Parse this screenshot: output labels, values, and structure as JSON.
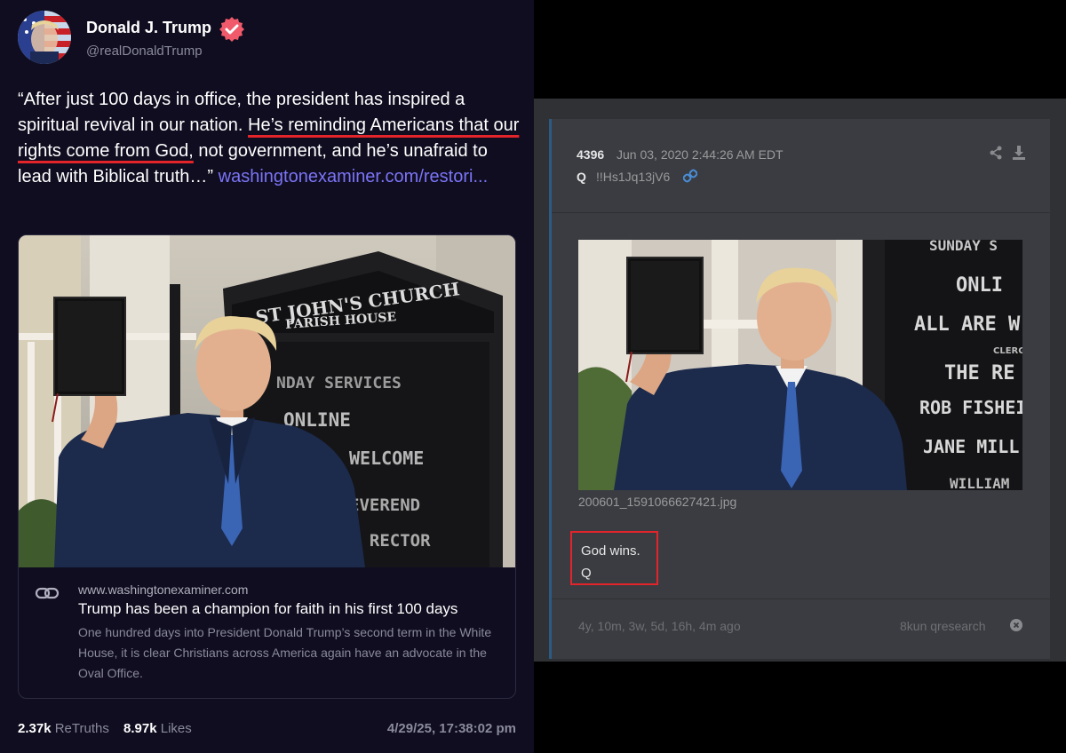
{
  "truth_post": {
    "author_name": "Donald J. Trump",
    "handle": "@realDonaldTrump",
    "text_before": "“After just 100 days in office, the president has inspired a spiritual revival in our nation. ",
    "text_underlined": "He’s reminding Americans that our rights come from God,",
    "text_after": " not government, and he’s unafraid to lead with Biblical truth…” ",
    "link_text": "washingtonexaminer.com/restori...",
    "card": {
      "domain": "www.washingtonexaminer.com",
      "title": "Trump has been a champion for faith in his first 100 days",
      "description": "One hundred days into President Donald Trump’s second term in the White House, it is clear Christians across America again have an advocate in the Oval Office.",
      "sign_line1": "ST JOHN'S CHURCH",
      "sign_line2": "PARISH HOUSE",
      "sign_line3": "NDAY  SERVICES",
      "sign_line4": "ONLINE",
      "sign_line5": "WELCOME",
      "sign_line6": "EVEREND",
      "sign_line7": ". RECTOR"
    },
    "retruths_count": "2.37k",
    "retruths_label": "ReTruths",
    "likes_count": "8.97k",
    "likes_label": "Likes",
    "timestamp": "4/29/25, 17:38:02 pm"
  },
  "q_post": {
    "post_number": "4396",
    "date": "Jun 03, 2020 2:44:26 AM EDT",
    "name": "Q",
    "tripcode": "!!Hs1Jq13jV6",
    "image_filename": "200601_1591066627421.jpg",
    "message_line1": "God wins.",
    "message_line2": "Q",
    "age": "4y, 10m, 3w, 5d, 16h, 4m ago",
    "board": "8kun qresearch",
    "sign_line1": "SUNDAY S",
    "sign_line2": "ONLI",
    "sign_line3": "ALL ARE W",
    "sign_line4": "CLERG",
    "sign_line5": "THE RE",
    "sign_line6": "ROB FISHEI",
    "sign_line7": "JANE MILL",
    "sign_line8": "WILLIAM"
  },
  "colors": {
    "truth_background": "#0f0d1f",
    "link": "#7b74f7",
    "highlight_red": "#e3242b",
    "q_post_background": "#3a3c41"
  },
  "icons": {
    "verified": "verified-badge-icon",
    "link": "link-chain-icon",
    "share": "share-icon",
    "download": "download-icon",
    "close": "close-circle-icon"
  }
}
